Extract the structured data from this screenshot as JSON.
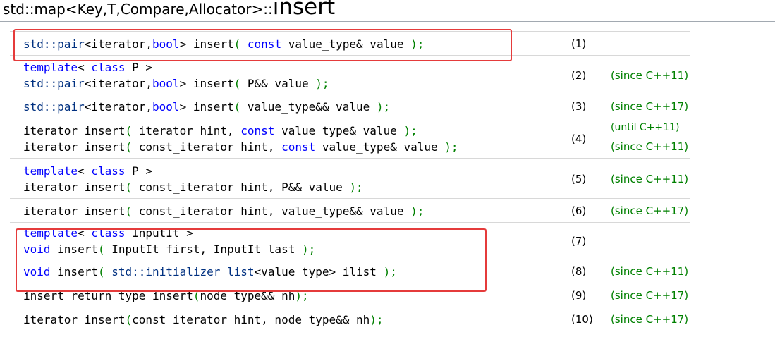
{
  "title": {
    "main": "std::map<Key,T,Compare,Allocator>::",
    "func": "insert"
  },
  "rows": [
    {
      "lines": [
        [
          [
            "std::",
            "cls"
          ],
          [
            "pair",
            "cls"
          ],
          [
            "<iterator,",
            ""
          ],
          [
            "bool",
            "kw"
          ],
          [
            "> insert",
            ""
          ],
          [
            "(",
            "sym"
          ],
          [
            " ",
            ""
          ],
          [
            "const",
            "kw"
          ],
          [
            " value_type& value ",
            ""
          ],
          [
            ");",
            "sym"
          ]
        ]
      ],
      "num": "(1)",
      "since": []
    },
    {
      "lines": [
        [
          [
            "template",
            "kw"
          ],
          [
            "< ",
            ""
          ],
          [
            "class",
            "kw"
          ],
          [
            " P >",
            ""
          ]
        ],
        [
          [
            "std::",
            "cls"
          ],
          [
            "pair",
            "cls"
          ],
          [
            "<iterator,",
            ""
          ],
          [
            "bool",
            "kw"
          ],
          [
            "> insert",
            ""
          ],
          [
            "(",
            "sym"
          ],
          [
            " P&& value ",
            ""
          ],
          [
            ");",
            "sym"
          ]
        ]
      ],
      "num": "(2)",
      "since": [
        "(since C++11)"
      ]
    },
    {
      "lines": [
        [
          [
            "std::",
            "cls"
          ],
          [
            "pair",
            "cls"
          ],
          [
            "<iterator,",
            ""
          ],
          [
            "bool",
            "kw"
          ],
          [
            "> insert",
            ""
          ],
          [
            "(",
            "sym"
          ],
          [
            " value_type&& value ",
            ""
          ],
          [
            ");",
            "sym"
          ]
        ]
      ],
      "num": "(3)",
      "since": [
        "(since C++17)"
      ]
    },
    {
      "lines": [
        [
          [
            "iterator insert",
            ""
          ],
          [
            "(",
            "sym"
          ],
          [
            " iterator hint, ",
            ""
          ],
          [
            "const",
            "kw"
          ],
          [
            " value_type& value ",
            ""
          ],
          [
            ");",
            "sym"
          ]
        ],
        [
          [
            "iterator insert",
            ""
          ],
          [
            "(",
            "sym"
          ],
          [
            " const_iterator hint, ",
            ""
          ],
          [
            "const",
            "kw"
          ],
          [
            " value_type& value ",
            ""
          ],
          [
            ");",
            "sym"
          ]
        ]
      ],
      "num": "(4)",
      "since": [
        "(until C++11)",
        "(since C++11)"
      ]
    },
    {
      "lines": [
        [
          [
            "template",
            "kw"
          ],
          [
            "< ",
            ""
          ],
          [
            "class",
            "kw"
          ],
          [
            " P >",
            ""
          ]
        ],
        [
          [
            "iterator insert",
            ""
          ],
          [
            "(",
            "sym"
          ],
          [
            " const_iterator hint, P&& value ",
            ""
          ],
          [
            ");",
            "sym"
          ]
        ]
      ],
      "num": "(5)",
      "since": [
        "(since C++11)"
      ]
    },
    {
      "lines": [
        [
          [
            "iterator insert",
            ""
          ],
          [
            "(",
            "sym"
          ],
          [
            " const_iterator hint, value_type&& value ",
            ""
          ],
          [
            ");",
            "sym"
          ]
        ]
      ],
      "num": "(6)",
      "since": [
        "(since C++17)"
      ]
    },
    {
      "lines": [
        [
          [
            "template",
            "kw"
          ],
          [
            "< ",
            ""
          ],
          [
            "class",
            "kw"
          ],
          [
            " InputIt >",
            ""
          ]
        ],
        [
          [
            "void",
            "kw"
          ],
          [
            " insert",
            ""
          ],
          [
            "(",
            "sym"
          ],
          [
            " InputIt first, InputIt last ",
            ""
          ],
          [
            ");",
            "sym"
          ]
        ]
      ],
      "num": "(7)",
      "since": []
    },
    {
      "lines": [
        [
          [
            "void",
            "kw"
          ],
          [
            " insert",
            ""
          ],
          [
            "(",
            "sym"
          ],
          [
            " ",
            ""
          ],
          [
            "std::",
            "cls"
          ],
          [
            "initializer_list",
            "cls"
          ],
          [
            "<value_type> ilist ",
            ""
          ],
          [
            ");",
            "sym"
          ]
        ]
      ],
      "num": "(8)",
      "since": [
        "(since C++11)"
      ]
    },
    {
      "lines": [
        [
          [
            "insert_return_type insert",
            ""
          ],
          [
            "(",
            "sym"
          ],
          [
            "node_type&& nh",
            ""
          ],
          [
            ");",
            "sym"
          ]
        ]
      ],
      "num": "(9)",
      "since": [
        "(since C++17)"
      ]
    },
    {
      "lines": [
        [
          [
            "iterator insert",
            ""
          ],
          [
            "(",
            "sym"
          ],
          [
            "const_iterator hint, node_type&& nh",
            ""
          ],
          [
            ");",
            "sym"
          ]
        ]
      ],
      "num": "(10)",
      "since": [
        "(since C++17)"
      ]
    }
  ],
  "highlights": [
    {
      "label": "overload-1-highlight",
      "rows": [
        0
      ]
    },
    {
      "label": "overloads-7-8-highlight",
      "rows": [
        6,
        7
      ]
    }
  ]
}
